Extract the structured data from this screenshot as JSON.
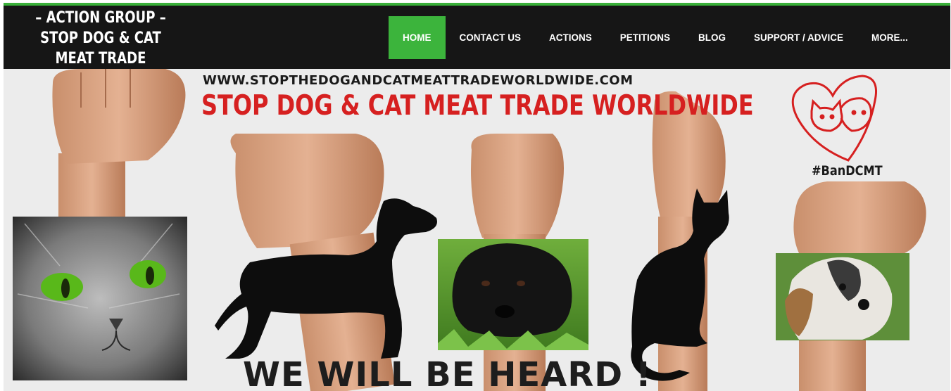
{
  "site_title": {
    "line1": "– ACTION GROUP –",
    "line2": "STOP DOG & CAT",
    "line3": "MEAT TRADE"
  },
  "nav": {
    "items": [
      {
        "label": "HOME",
        "active": true
      },
      {
        "label": "CONTACT US"
      },
      {
        "label": "ACTIONS"
      },
      {
        "label": "PETITIONS"
      },
      {
        "label": "BLOG"
      },
      {
        "label": "SUPPORT / ADVICE"
      },
      {
        "label": "MORE..."
      }
    ]
  },
  "banner": {
    "url": "WWW.STOPTHEDOGANDCATMEATTRADEWORLDWIDE.COM",
    "headline": "STOP DOG & CAT MEAT TRADE WORLDWIDE",
    "hashtag": "#BanDCMT",
    "slogan": "WE WILL BE HEARD !"
  },
  "colors": {
    "header_bg": "#161616",
    "accent_green": "#3cb43c",
    "headline_red": "#d62020"
  }
}
